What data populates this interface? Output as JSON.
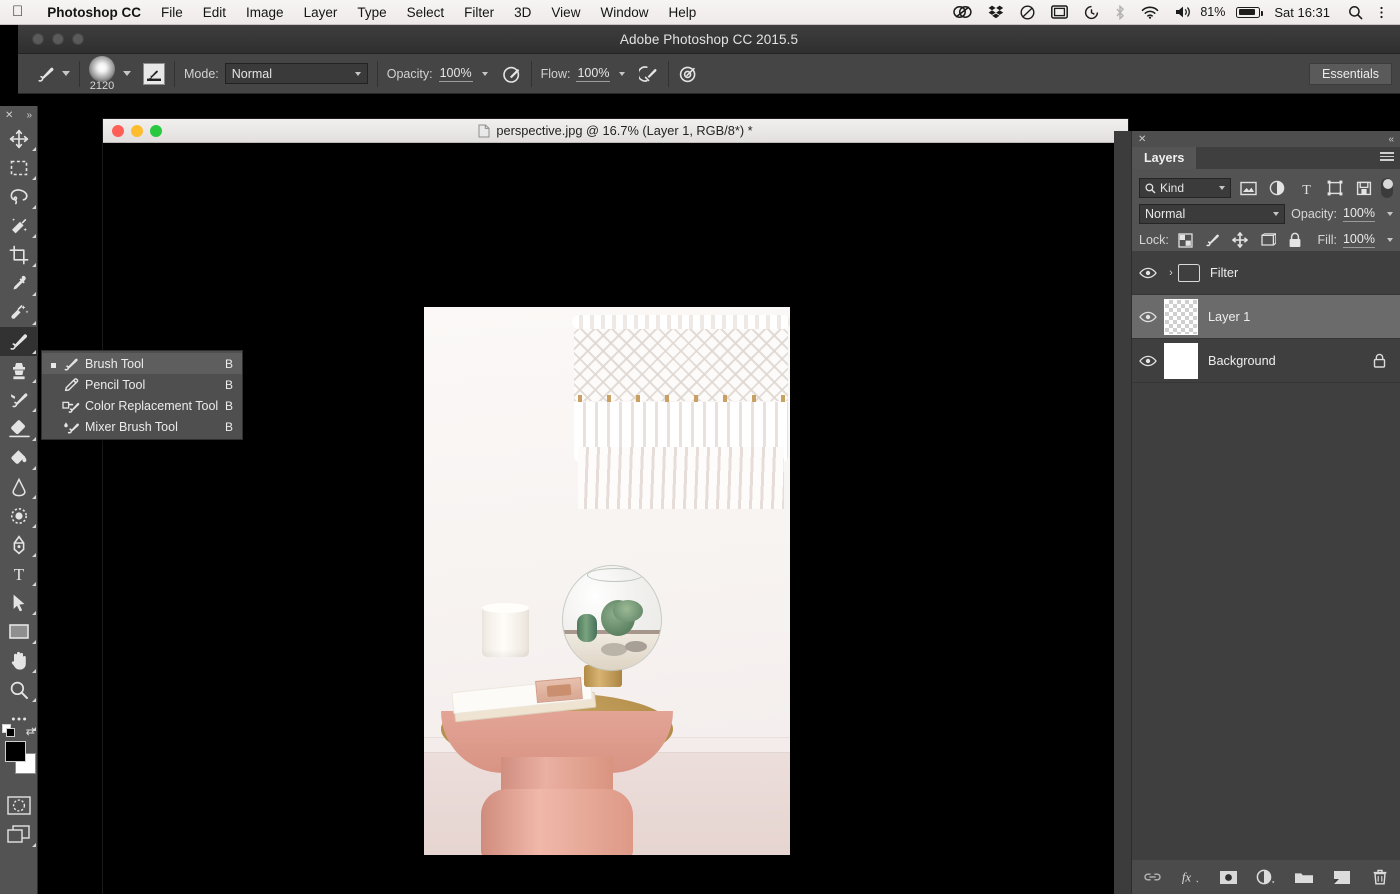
{
  "macos_menubar": {
    "apple_icon": "apple-logo-icon",
    "items": [
      {
        "label": "Photoshop CC",
        "bold": true
      },
      {
        "label": "File"
      },
      {
        "label": "Edit"
      },
      {
        "label": "Image"
      },
      {
        "label": "Layer"
      },
      {
        "label": "Type"
      },
      {
        "label": "Select"
      },
      {
        "label": "Filter"
      },
      {
        "label": "3D"
      },
      {
        "label": "View"
      },
      {
        "label": "Window"
      },
      {
        "label": "Help"
      }
    ],
    "status_icons": [
      "creative-cloud-icon",
      "dropbox-icon",
      "do-not-disturb-icon",
      "display-icon",
      "time-machine-icon",
      "bluetooth-icon",
      "wifi-icon",
      "volume-icon"
    ],
    "battery_percent": "81%",
    "clock": "Sat 16:31",
    "search_icon": "spotlight-search-icon",
    "menu_extras_icon": "control-center-icon"
  },
  "app_window": {
    "title": "Adobe Photoshop CC 2015.5"
  },
  "options_bar": {
    "tool_icon": "brush-tool-icon",
    "brush_preset_size": "2120",
    "tablet_pressure_icon": "brush-panel-toggle-icon",
    "mode_label": "Mode:",
    "mode_value": "Normal",
    "opacity_label": "Opacity:",
    "opacity_value": "100%",
    "pressure_opacity_icon": "tablet-pressure-opacity-icon",
    "flow_label": "Flow:",
    "flow_value": "100%",
    "airbrush_icon": "airbrush-icon",
    "pressure_size_icon": "tablet-pressure-size-icon",
    "workspace_button": "Essentials"
  },
  "toolbar": {
    "collapse_icon": "double-chevron-icon",
    "close_icon": "close-icon",
    "tools": [
      {
        "name": "move-tool",
        "has_flyout": true
      },
      {
        "name": "rectangular-marquee-tool",
        "has_flyout": true
      },
      {
        "name": "lasso-tool",
        "has_flyout": true
      },
      {
        "name": "quick-selection-tool",
        "has_flyout": true
      },
      {
        "name": "crop-tool",
        "has_flyout": true
      },
      {
        "name": "eyedropper-tool",
        "has_flyout": true
      },
      {
        "name": "spot-healing-brush-tool",
        "has_flyout": true
      },
      {
        "name": "brush-tool",
        "has_flyout": true,
        "selected": true
      },
      {
        "name": "clone-stamp-tool",
        "has_flyout": true
      },
      {
        "name": "history-brush-tool",
        "has_flyout": true
      },
      {
        "name": "eraser-tool",
        "has_flyout": true
      },
      {
        "name": "gradient-tool",
        "has_flyout": true
      },
      {
        "name": "blur-tool",
        "has_flyout": true
      },
      {
        "name": "dodge-tool",
        "has_flyout": true
      },
      {
        "name": "pen-tool",
        "has_flyout": true
      },
      {
        "name": "horizontal-type-tool",
        "has_flyout": true
      },
      {
        "name": "path-selection-tool",
        "has_flyout": true
      },
      {
        "name": "rectangle-tool",
        "has_flyout": true
      },
      {
        "name": "hand-tool",
        "has_flyout": true
      },
      {
        "name": "zoom-tool",
        "has_flyout": true
      },
      {
        "name": "edit-toolbar-tool",
        "has_flyout": true
      }
    ],
    "default_colors_icon": "default-colors-icon",
    "swap_colors_icon": "swap-colors-icon",
    "foreground_color": "#000000",
    "background_color": "#ffffff",
    "quick_mask_icon": "quick-mask-mode-icon",
    "screen_mode_icon": "screen-mode-icon"
  },
  "tool_flyout": {
    "items": [
      {
        "label": "Brush Tool",
        "shortcut": "B",
        "icon": "brush-tool-icon",
        "active": true
      },
      {
        "label": "Pencil Tool",
        "shortcut": "B",
        "icon": "pencil-tool-icon",
        "active": false
      },
      {
        "label": "Color Replacement Tool",
        "shortcut": "B",
        "icon": "color-replacement-tool-icon",
        "active": false
      },
      {
        "label": "Mixer Brush Tool",
        "shortcut": "B",
        "icon": "mixer-brush-tool-icon",
        "active": false
      }
    ]
  },
  "document": {
    "title": "perspective.jpg @ 16.7% (Layer 1, RGB/8*) *",
    "file_icon": "document-icon",
    "traffic_lights": [
      "close-button",
      "minimize-button",
      "zoom-button"
    ],
    "zoom_level": "16.7%",
    "color_mode": "RGB/8*",
    "active_layer": "Layer 1",
    "artwork_description": "Photograph of a pink pedestal side table with brass top holding a glass terrarium with cacti, a white candle, stacked books and a matchbox, beneath a white macrame wall hanging"
  },
  "layers_panel": {
    "close_icon": "close-icon",
    "collapse_icon": "double-chevron-left-icon",
    "tab_label": "Layers",
    "menu_icon": "panel-menu-icon",
    "filter": {
      "search_icon": "search-icon",
      "kind_label": "Kind",
      "type_filters": [
        "filter-pixel-layers-icon",
        "filter-adjustment-layers-icon",
        "filter-type-layers-icon",
        "filter-shape-layers-icon",
        "filter-smart-objects-icon"
      ],
      "toggle_icon": "filter-enable-toggle"
    },
    "blend_mode": "Normal",
    "opacity_label": "Opacity:",
    "opacity_value": "100%",
    "lock_label": "Lock:",
    "lock_icons": [
      "lock-transparent-pixels-icon",
      "lock-image-pixels-icon",
      "lock-position-icon",
      "lock-artboard-nesting-icon",
      "lock-all-icon"
    ],
    "fill_label": "Fill:",
    "fill_value": "100%",
    "layers": [
      {
        "name": "Filter",
        "type": "group",
        "visible": true,
        "selected": false,
        "expanded": false,
        "locked": false,
        "thumb": "folder"
      },
      {
        "name": "Layer 1",
        "type": "pixel",
        "visible": true,
        "selected": true,
        "locked": false,
        "thumb": "transparent-checkerboard"
      },
      {
        "name": "Background",
        "type": "pixel",
        "visible": true,
        "selected": false,
        "locked": true,
        "thumb": "photo"
      }
    ],
    "footer_buttons": [
      "link-layers-icon",
      "add-layer-style-icon",
      "add-layer-mask-icon",
      "new-adjustment-layer-icon",
      "new-group-icon",
      "new-layer-icon",
      "delete-layer-icon"
    ]
  },
  "colors": {
    "app_chrome": "#535353",
    "panel_bg": "#4e4e4e",
    "layer_list_bg": "#3f3f3f",
    "selected_layer": "#6b6b6b",
    "options_bar": "#454545",
    "canvas_bg": "#000000",
    "text": "#eeeeee",
    "menubar_bg": "#f2efef"
  }
}
